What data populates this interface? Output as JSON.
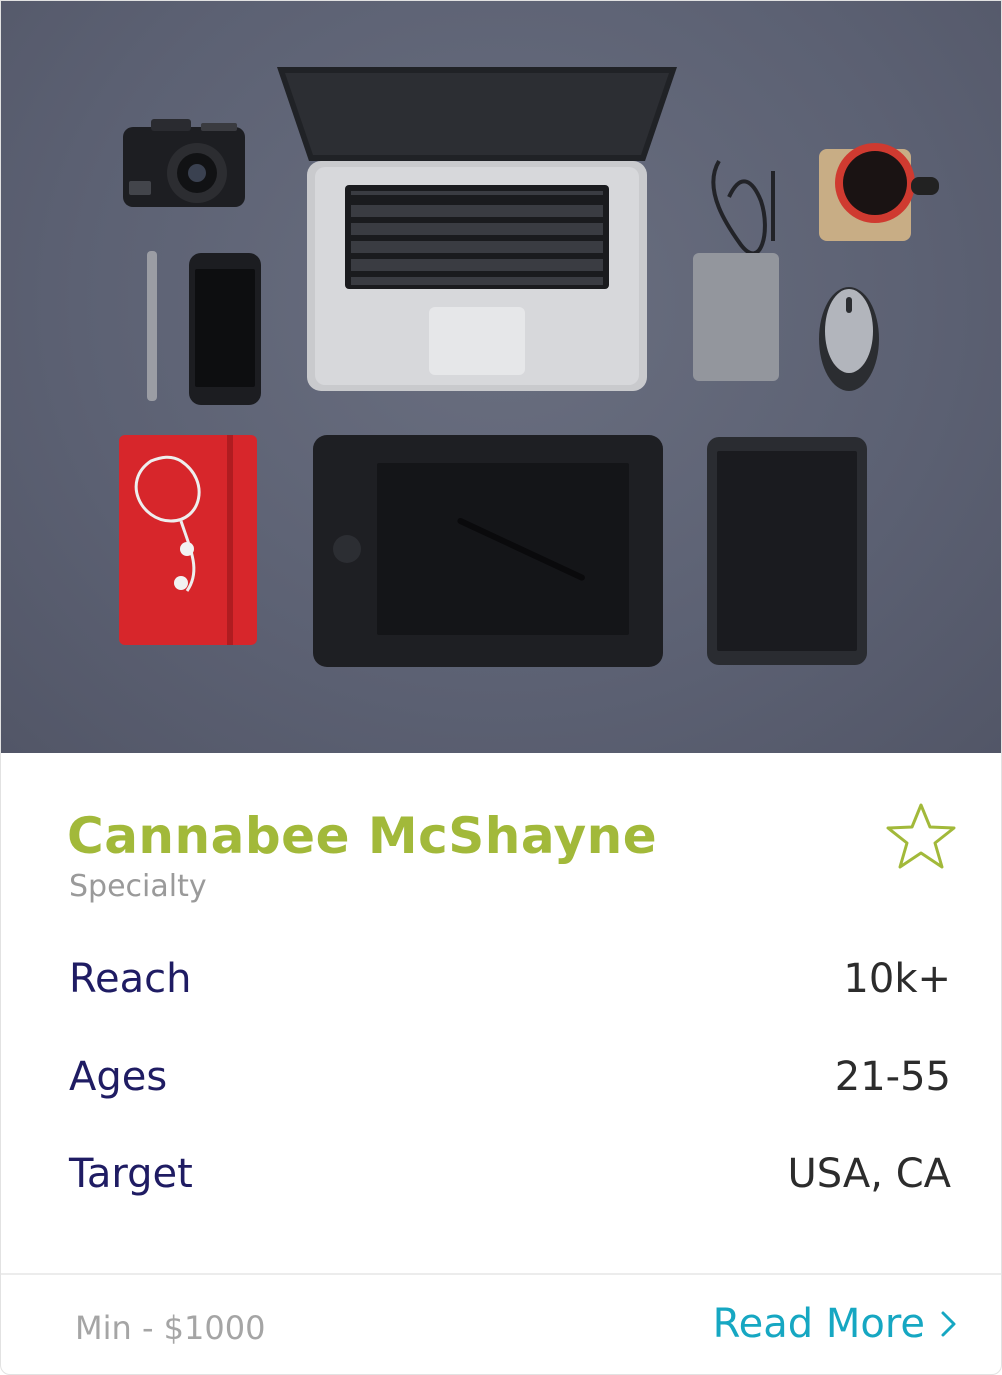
{
  "profile": {
    "name": "Cannabee McShayne",
    "specialty": "Specialty",
    "favorite_icon": "star-outline-icon"
  },
  "stats": [
    {
      "label": "Reach",
      "value": "10k+"
    },
    {
      "label": "Ages",
      "value": "21-55"
    },
    {
      "label": "Target",
      "value": "USA, CA"
    }
  ],
  "footer": {
    "min_price": "Min - $1000",
    "read_more": "Read More",
    "read_more_icon": "chevron-right-icon"
  },
  "colors": {
    "name": "#a2b93a",
    "label": "#1f1c63",
    "link": "#16a7c2",
    "muted": "#9a9a9a",
    "hero_bg": "#5c6173"
  }
}
